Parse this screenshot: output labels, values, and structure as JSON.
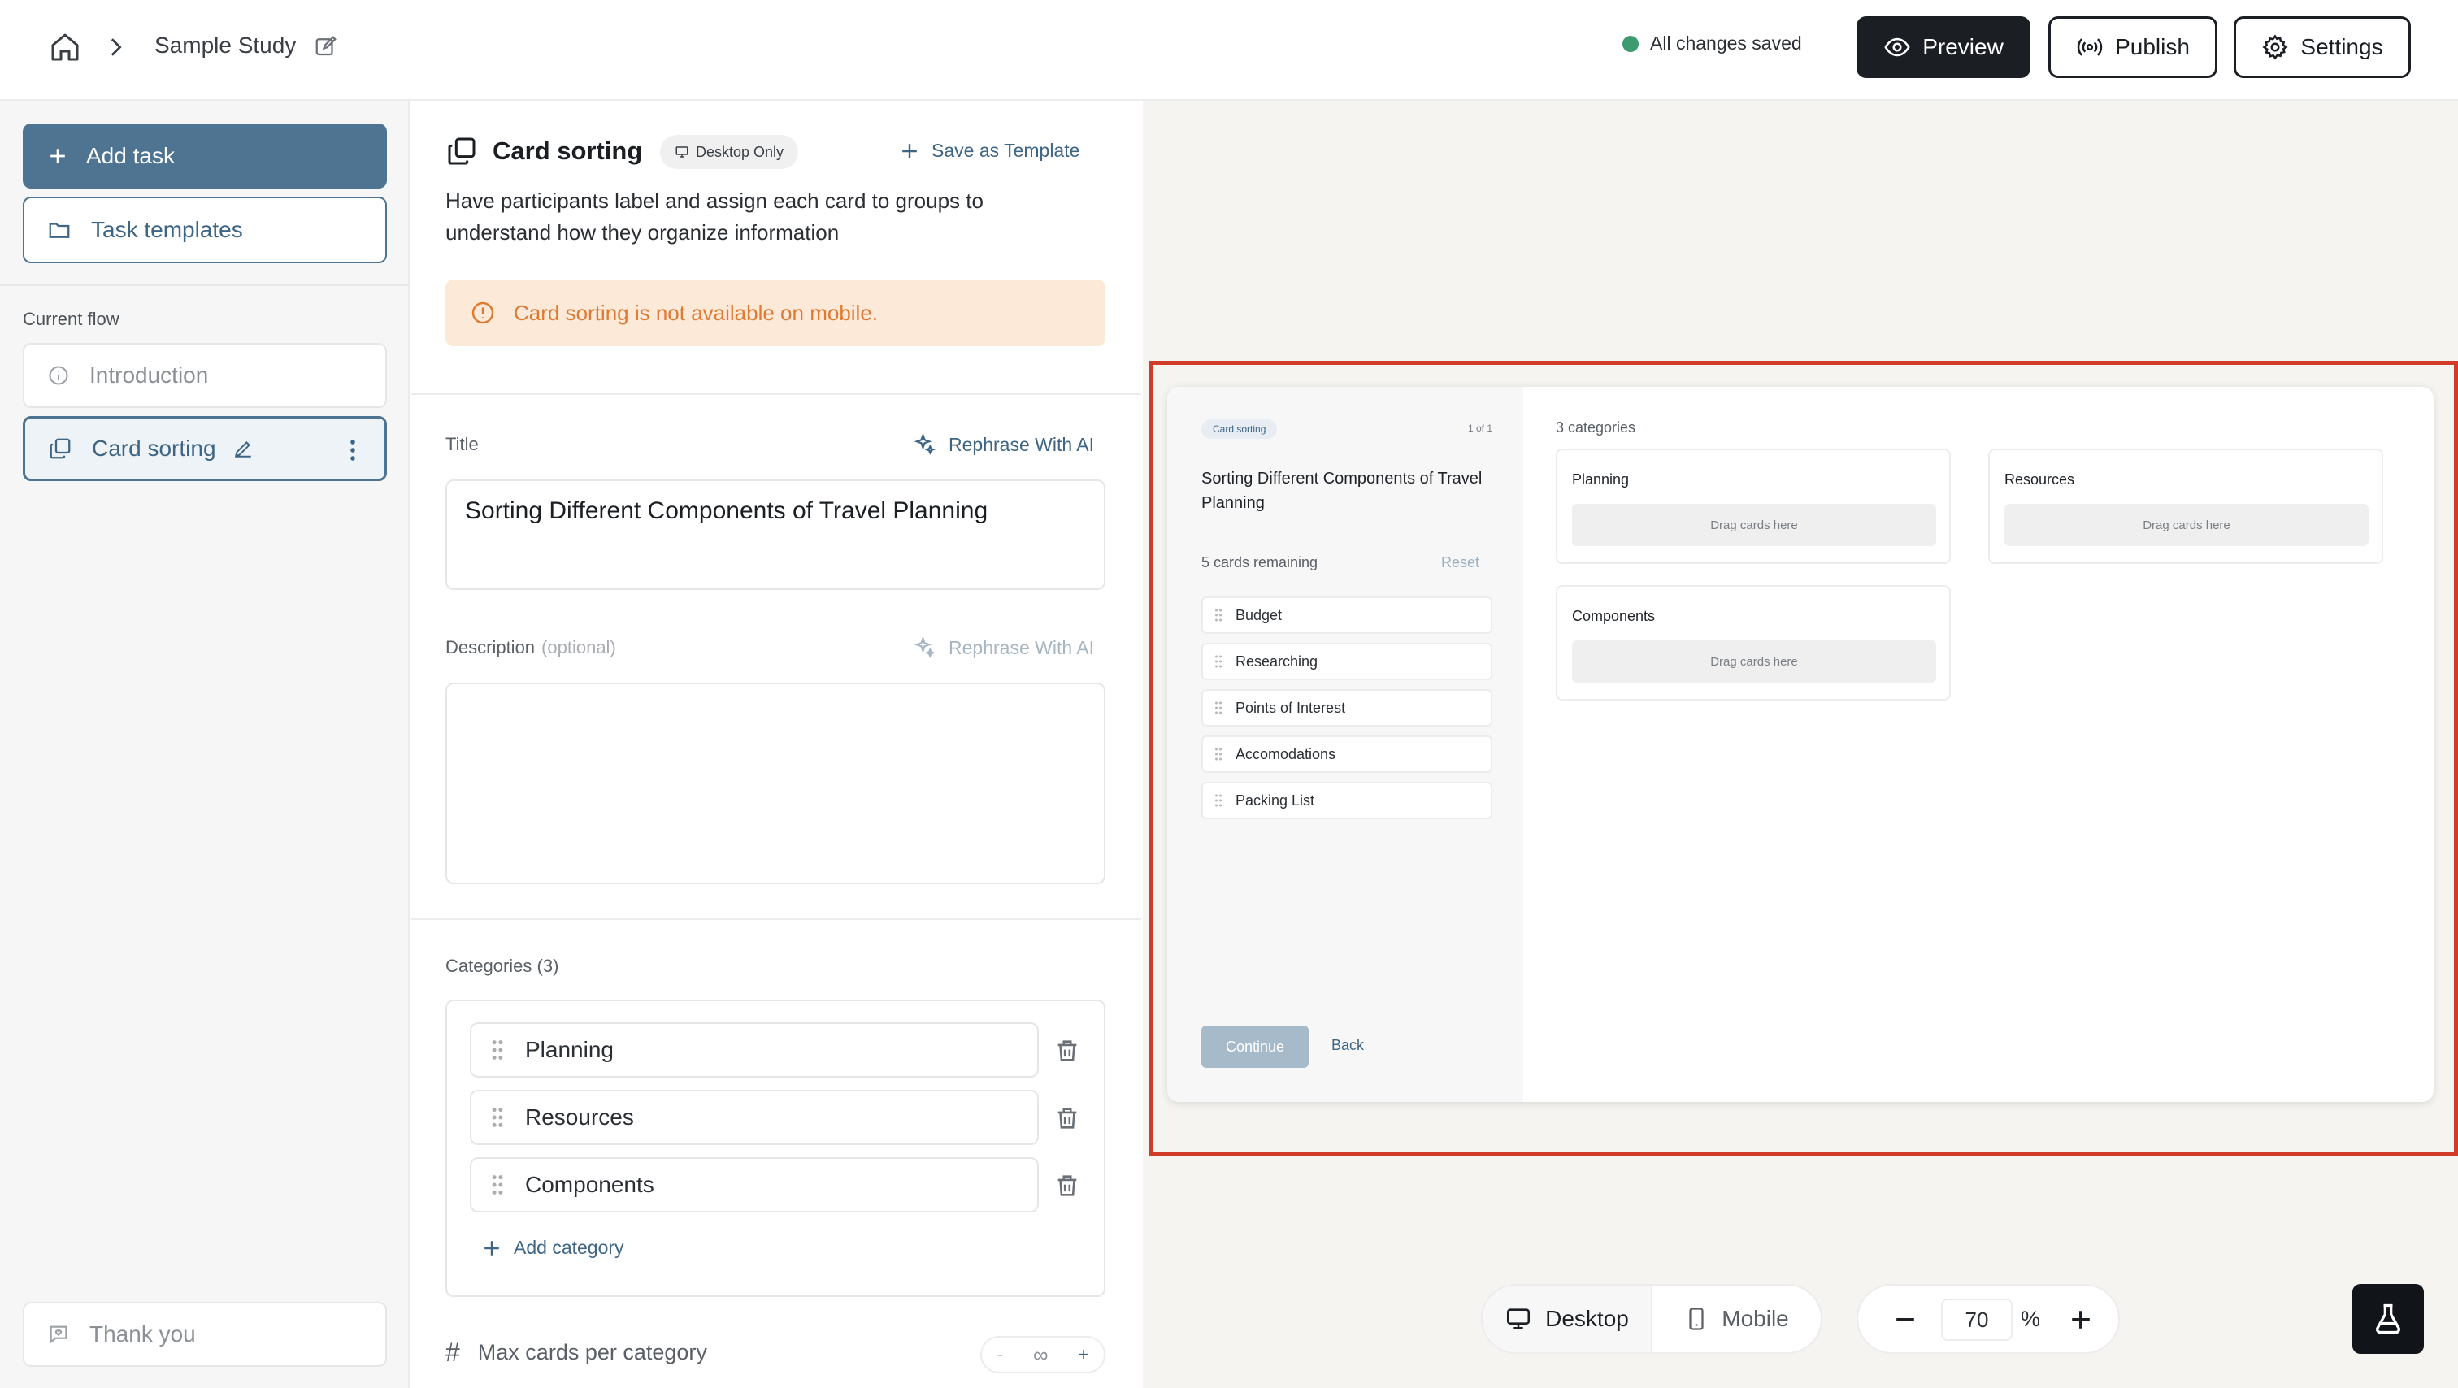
{
  "header": {
    "study_name": "Sample Study",
    "save_status": "All changes saved",
    "preview_label": "Preview",
    "publish_label": "Publish",
    "settings_label": "Settings"
  },
  "sidebar": {
    "add_task_label": "Add task",
    "task_templates_label": "Task templates",
    "current_flow_label": "Current flow",
    "flow_items": [
      {
        "label": "Introduction",
        "icon": "info-icon"
      },
      {
        "label": "Card sorting",
        "icon": "card-sorting-icon",
        "selected": true
      },
      {
        "label": "Thank you",
        "icon": "thank-you-icon"
      }
    ]
  },
  "editor": {
    "task_type": "Card sorting",
    "platform_badge": "Desktop Only",
    "save_template_label": "Save as Template",
    "task_description": "Have participants label and assign each card to groups to understand how they organize information",
    "mobile_warning": "Card sorting is not available on mobile.",
    "title_label": "Title",
    "rephrase_label": "Rephrase With AI",
    "title_value": "Sorting Different Components of Travel Planning",
    "description_label": "Description",
    "description_optional": "(optional)",
    "description_value": "",
    "categories_label": "Categories (3)",
    "categories": [
      "Planning",
      "Resources",
      "Components"
    ],
    "add_category_label": "Add category",
    "max_cards_label": "Max cards per category",
    "max_cards_minus": "-",
    "max_cards_value": "∞",
    "max_cards_plus": "+"
  },
  "preview": {
    "badge": "Card sorting",
    "step_count": "1 of 1",
    "title": "Sorting Different Components of Travel Planning",
    "cards_remaining": "5 cards remaining",
    "reset_label": "Reset",
    "cards": [
      "Budget",
      "Researching",
      "Points of Interest",
      "Accomodations",
      "Packing List"
    ],
    "continue_label": "Continue",
    "back_label": "Back",
    "categories_count": "3 categories",
    "categories": [
      "Planning",
      "Resources",
      "Components"
    ],
    "drop_hint": "Drag cards here"
  },
  "controls": {
    "desktop_label": "Desktop",
    "mobile_label": "Mobile",
    "zoom_value": "70",
    "zoom_unit": "%"
  },
  "colors": {
    "accent": "#4f7492",
    "highlight": "#d13c2a",
    "saved_dot": "#3e9b6f",
    "warning_text": "#e07a32"
  }
}
